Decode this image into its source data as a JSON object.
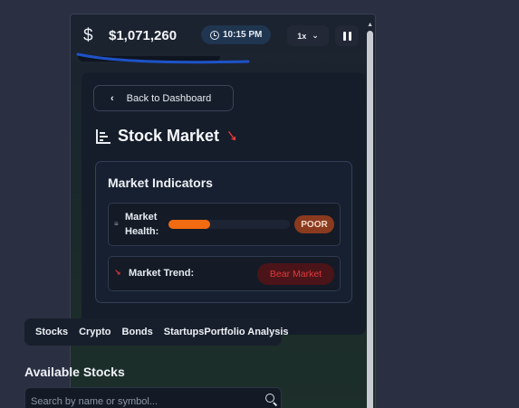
{
  "header": {
    "currency_symbol": "$",
    "balance": "$1,071,260",
    "time": "10:15 PM",
    "speed": "1x"
  },
  "panel": {
    "back_label": "Back to Dashboard",
    "title": "Stock Market",
    "indicators": {
      "title": "Market Indicators",
      "health_label_line1": "Market",
      "health_label_line2": "Health:",
      "health_level": 0.34,
      "health_status": "POOR",
      "trend_label": "Market Trend:",
      "trend_status": "Bear Market"
    }
  },
  "tabs": [
    "Stocks",
    "Crypto",
    "Bonds",
    "Startups",
    "Portfolio Analysis"
  ],
  "stocks": {
    "section_title": "Available Stocks",
    "search_placeholder": "Search by name or symbol..."
  },
  "colors": {
    "health_fill": "#f26b10",
    "poor_badge": "#8a3a1e",
    "bear_badge_bg": "#4a1418",
    "bear_text": "#e03a3e",
    "underline": "#1e52c8"
  }
}
